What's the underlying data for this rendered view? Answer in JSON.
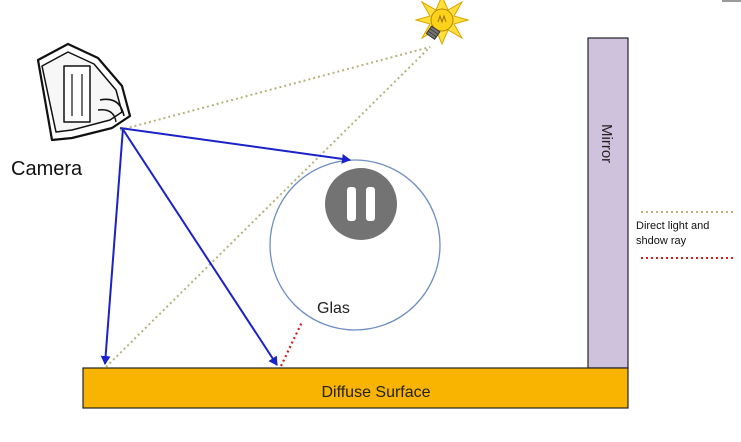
{
  "labels": {
    "camera": "Camera",
    "mirror": "Mirror",
    "glass": "Glas",
    "surface": "Diffuse Surface"
  },
  "legend": {
    "direct_light_line1": "Direct light and",
    "direct_light_line2": "shdow ray"
  },
  "colors": {
    "camera_ray": "#1a22c8",
    "direct_light_ray": "#b5b37a",
    "shadow_ray": "#cc1f1f",
    "mirror_fill": "#cfc2dc",
    "surface_fill": "#f8b400",
    "glass_stroke": "#6f8fc2",
    "light_bulb": "#ffd21a"
  },
  "icons": {
    "camera": "camera-icon",
    "light": "light-bulb-icon",
    "pause": "pause-icon"
  },
  "player": {
    "state": "paused"
  }
}
